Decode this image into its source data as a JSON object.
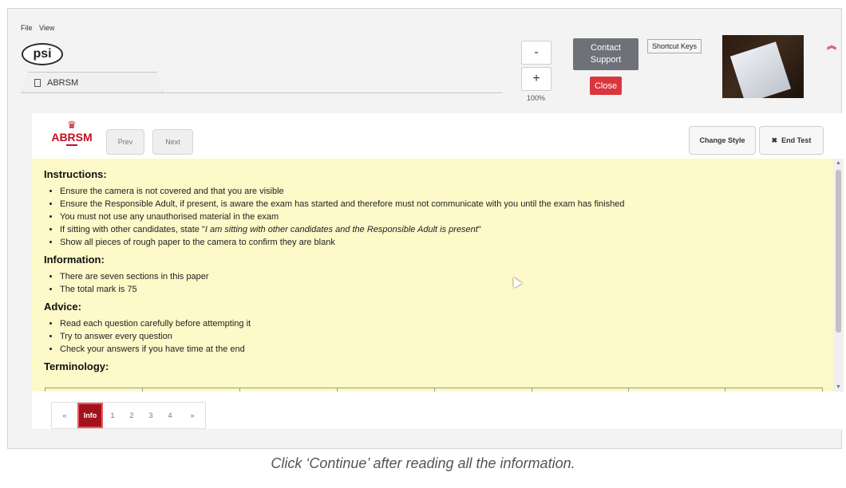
{
  "menu": {
    "file": "File",
    "view": "View"
  },
  "logo": {
    "psi_text": "psi"
  },
  "tab": {
    "label": "ABRSM"
  },
  "zoom": {
    "minus": "-",
    "plus": "+",
    "level": "100%"
  },
  "support": {
    "contact_label_1": "Contact",
    "contact_label_2": "Support",
    "close_label": "Close",
    "shortcut_label": "Shortcut Keys"
  },
  "exam": {
    "logo_text": "ABRSM",
    "prev_label": "Prev",
    "next_label": "Next",
    "change_style_label": "Change Style",
    "end_test_icon": "✖",
    "end_test_label": "End Test"
  },
  "content": {
    "instructions": {
      "title": "Instructions:",
      "items": [
        "Ensure the camera is not covered and that you are visible",
        "Ensure the Responsible Adult, if present, is aware the exam has started and therefore must not communicate with you until the exam has finished",
        "You must not use any unauthorised material in the exam",
        "Show all pieces of rough paper to the camera to confirm they are blank"
      ],
      "quote_prefix": "If sitting with other candidates, state \"",
      "quote_text": "I am sitting with other candidates and the Responsible Adult is present",
      "quote_suffix": "\""
    },
    "information": {
      "title": "Information:",
      "items": [
        "There are seven sections in this paper",
        "The total mark is 75"
      ]
    },
    "advice": {
      "title": "Advice:",
      "items": [
        "Read each question carefully before attempting it",
        "Try to answer every question",
        "Check your answers if you have time at the end"
      ]
    },
    "terminology": {
      "title": "Terminology:"
    }
  },
  "pagination": {
    "first": "«",
    "info": "Info",
    "pages": [
      "1",
      "2",
      "3",
      "4"
    ],
    "last": "»"
  },
  "footer": {
    "text": "Click ‘Continue’ after reading all the information."
  },
  "colors": {
    "close_red": "#d9363e",
    "brand_red": "#c0121f",
    "content_bg": "#fdf9c8",
    "contact_gray": "#6e7278"
  }
}
